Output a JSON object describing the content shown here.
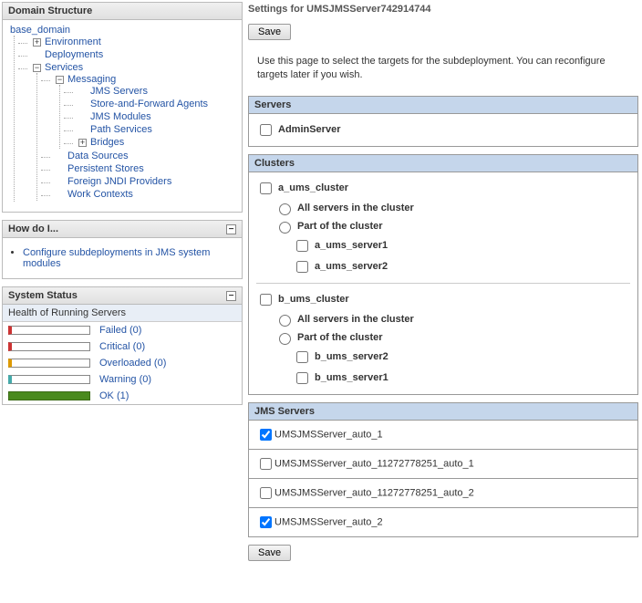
{
  "left": {
    "domainStructureTitle": "Domain Structure",
    "howDoITitle": "How do I...",
    "systemStatusTitle": "System Status",
    "healthSubHeader": "Health of Running Servers",
    "tree": {
      "root": "base_domain",
      "environment": "Environment",
      "deployments": "Deployments",
      "services": "Services",
      "messaging": "Messaging",
      "jmsServers": "JMS Servers",
      "storeAndForward": "Store-and-Forward Agents",
      "jmsModules": "JMS Modules",
      "pathServices": "Path Services",
      "bridges": "Bridges",
      "dataSources": "Data Sources",
      "persistentStores": "Persistent Stores",
      "foreignJNDI": "Foreign JNDI Providers",
      "workContexts": "Work Contexts"
    },
    "howDoILinks": [
      "Configure subdeployments in JMS system modules"
    ],
    "health": [
      {
        "label": "Failed (0)",
        "class": "failed"
      },
      {
        "label": "Critical (0)",
        "class": "critical"
      },
      {
        "label": "Overloaded (0)",
        "class": "overloaded"
      },
      {
        "label": "Warning (0)",
        "class": "warning"
      },
      {
        "label": "OK (1)",
        "class": "ok"
      }
    ]
  },
  "right": {
    "title": "Settings for UMSJMSServer742914744",
    "save": "Save",
    "intro": "Use this page to select the targets for the subdeployment. You can reconfigure targets later if you wish.",
    "serversHeader": "Servers",
    "clustersHeader": "Clusters",
    "jmsServersHeader": "JMS Servers",
    "servers": [
      {
        "label": "AdminServer",
        "checked": false
      }
    ],
    "clusters": [
      {
        "label": "a_ums_cluster",
        "allLabel": "All servers in the cluster",
        "partLabel": "Part of the cluster",
        "servers": [
          "a_ums_server1",
          "a_ums_server2"
        ]
      },
      {
        "label": "b_ums_cluster",
        "allLabel": "All servers in the cluster",
        "partLabel": "Part of the cluster",
        "servers": [
          "b_ums_server2",
          "b_ums_server1"
        ]
      }
    ],
    "jmsServers": [
      {
        "label": "UMSJMSServer_auto_1",
        "checked": true
      },
      {
        "label": "UMSJMSServer_auto_11272778251_auto_1",
        "checked": false
      },
      {
        "label": "UMSJMSServer_auto_11272778251_auto_2",
        "checked": false
      },
      {
        "label": "UMSJMSServer_auto_2",
        "checked": true
      }
    ]
  }
}
